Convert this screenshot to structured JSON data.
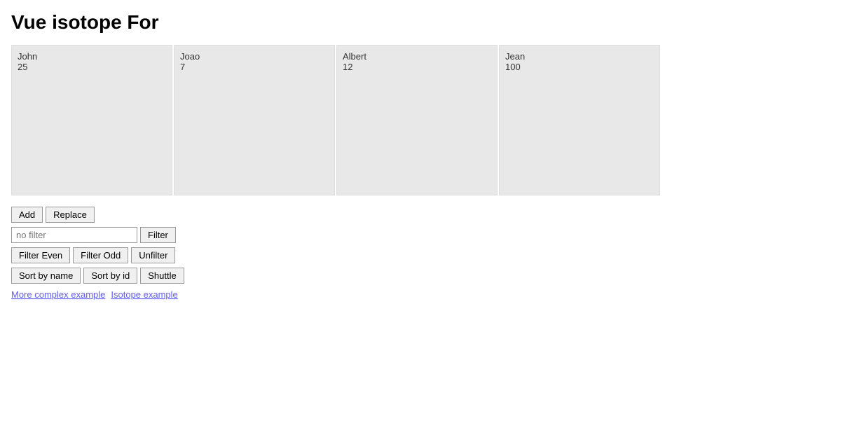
{
  "page": {
    "title": "Vue isotope For"
  },
  "cards": [
    {
      "name": "John",
      "id": "25"
    },
    {
      "name": "Joao",
      "id": "7"
    },
    {
      "name": "Albert",
      "id": "12"
    },
    {
      "name": "Jean",
      "id": "100"
    }
  ],
  "buttons": {
    "add": "Add",
    "replace": "Replace",
    "filter": "Filter",
    "filter_even": "Filter Even",
    "filter_odd": "Filter Odd",
    "unfilter": "Unfilter",
    "sort_by_name": "Sort by name",
    "sort_by_id": "Sort by id",
    "shuttle": "Shuttle"
  },
  "filter_input": {
    "placeholder": "no filter",
    "value": ""
  },
  "links": [
    {
      "label": "More complex example",
      "href": "#"
    },
    {
      "label": "Isotope example",
      "href": "#"
    }
  ]
}
